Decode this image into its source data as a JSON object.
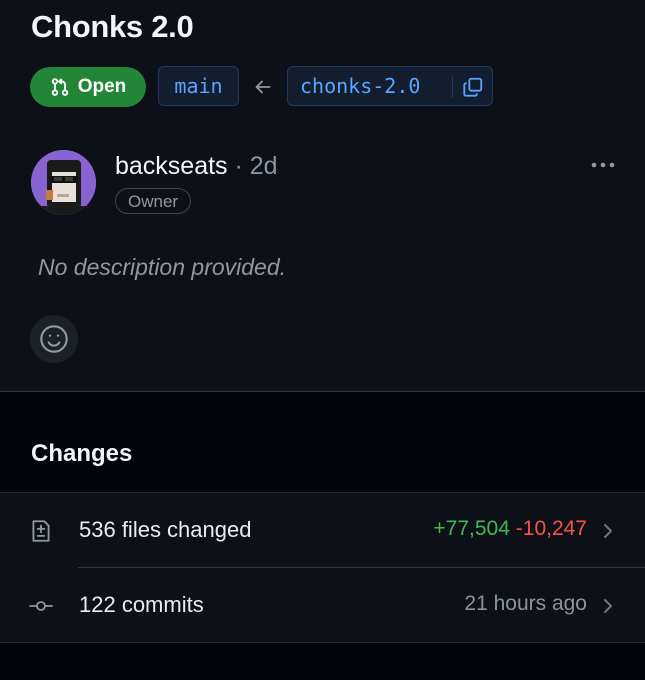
{
  "pull_request": {
    "title": "Chonks 2.0",
    "state_label": "Open",
    "base_branch": "main",
    "head_branch": "chonks-2.0"
  },
  "author": {
    "name": "backseats",
    "separator": " · ",
    "time": "2d",
    "role": "Owner"
  },
  "description": "No description provided.",
  "changes": {
    "heading": "Changes",
    "files": {
      "label": "536 files changed",
      "additions": "+77,504",
      "deletions": "-10,247"
    },
    "commits": {
      "label": "122 commits",
      "time": "21 hours ago"
    }
  },
  "icons": {
    "pr_state": "git-pull-request-icon",
    "arrow": "arrow-left-icon",
    "copy": "copy-icon",
    "more": "kebab-horizontal-icon",
    "reaction": "smiley-icon",
    "files": "file-diff-icon",
    "commits": "git-commit-icon",
    "chevron": "chevron-right-icon"
  },
  "colors": {
    "open_green": "#238636",
    "branch_blue": "#58a6ff",
    "additions": "#3fb950",
    "deletions": "#f85149"
  }
}
